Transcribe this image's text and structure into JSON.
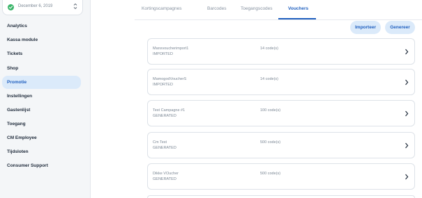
{
  "sidebar": {
    "date": "December 6, 2019",
    "items": [
      {
        "label": "Analytics",
        "active": false
      },
      {
        "label": "Kassa module",
        "active": false
      },
      {
        "label": "Tickets",
        "active": false
      },
      {
        "label": "Shop",
        "active": false
      },
      {
        "label": "Promotie",
        "active": true
      },
      {
        "label": "Instellingen",
        "active": false
      },
      {
        "label": "Gastenlijst",
        "active": false
      },
      {
        "label": "Toegang",
        "active": false
      },
      {
        "label": "CM Employee",
        "active": false
      },
      {
        "label": "Tijdsloten",
        "active": false
      },
      {
        "label": "Consumer Support",
        "active": false
      }
    ]
  },
  "tabs": [
    {
      "label": "Kortingscampagnes",
      "active": false
    },
    {
      "label": "Barcodes",
      "active": false
    },
    {
      "label": "Toegangscodes",
      "active": false
    },
    {
      "label": "Vouchers",
      "active": true
    }
  ],
  "actions": {
    "import_label": "Importeer",
    "generate_label": "Genereer"
  },
  "vouchers": [
    {
      "name": "Manxvoucherimport1",
      "status": "IMPORTED",
      "count": "14 code(s)"
    },
    {
      "name": "MamogodVoucherS",
      "status": "IMPORTED",
      "count": "14 code(s)"
    },
    {
      "name": "Test Campagne #1",
      "status": "GENERATED",
      "count": "100 code(s)"
    },
    {
      "name": "Cm Test",
      "status": "GENERATED",
      "count": "500 code(s)"
    },
    {
      "name": "Dikke VOucher",
      "status": "GENERATED",
      "count": "500 code(s)"
    }
  ],
  "colors": {
    "accent": "#1f5fbf",
    "accent_bg": "#dbeafa",
    "check_green": "#3bb56a"
  },
  "icons": {
    "date_status": "check-circle-icon",
    "date_select": "chevron-up-down-icon",
    "card_open": "chevron-right-icon"
  }
}
